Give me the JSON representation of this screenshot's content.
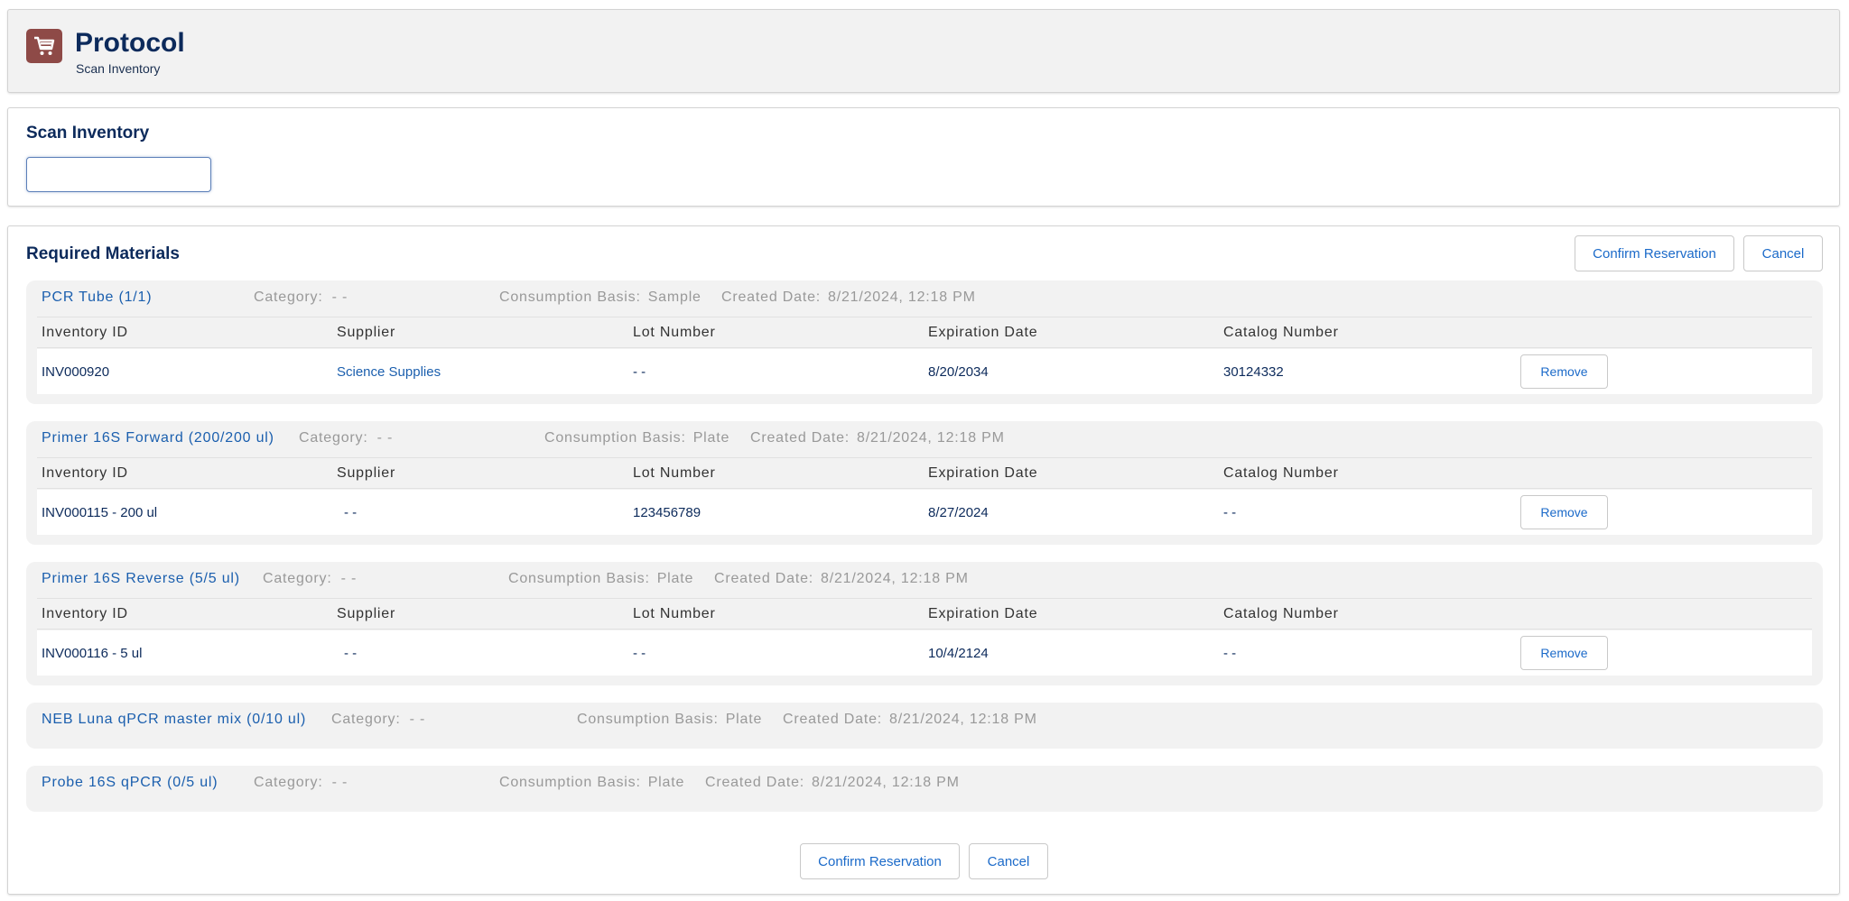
{
  "header": {
    "icon": "shopping-cart-icon",
    "icon_color": "#8e4a47",
    "title": "Protocol",
    "subtitle": "Scan Inventory"
  },
  "scan": {
    "label": "Scan Inventory",
    "input_value": "",
    "input_placeholder": ""
  },
  "materials": {
    "title": "Required Materials",
    "confirm_label": "Confirm Reservation",
    "cancel_label": "Cancel",
    "category_label": "Category:",
    "consumption_label": "Consumption Basis:",
    "created_label": "Created Date:",
    "columns": [
      "Inventory ID",
      "Supplier",
      "Lot Number",
      "Expiration Date",
      "Catalog Number"
    ],
    "remove_label": "Remove",
    "groups": [
      {
        "name": "PCR Tube (1/1)",
        "category": "- -",
        "consumption_basis": "Sample",
        "created_date": "8/21/2024, 12:18 PM",
        "rows": [
          {
            "inventory_id": "INV000920",
            "supplier": "Science Supplies",
            "lot_number": "- -",
            "expiration_date": "8/20/2034",
            "catalog_number": "30124332"
          }
        ]
      },
      {
        "name": "Primer 16S Forward (200/200 ul)",
        "category": "- -",
        "consumption_basis": "Plate",
        "created_date": "8/21/2024, 12:18 PM",
        "rows": [
          {
            "inventory_id": "INV000115 - 200 ul",
            "supplier": "- -",
            "lot_number": "123456789",
            "expiration_date": "8/27/2024",
            "catalog_number": "- -"
          }
        ]
      },
      {
        "name": "Primer 16S Reverse (5/5 ul)",
        "category": "- -",
        "consumption_basis": "Plate",
        "created_date": "8/21/2024, 12:18 PM",
        "rows": [
          {
            "inventory_id": "INV000116 - 5 ul",
            "supplier": "- -",
            "lot_number": "- -",
            "expiration_date": "10/4/2124",
            "catalog_number": "- -"
          }
        ]
      },
      {
        "name": "NEB Luna qPCR master mix (0/10 ul)",
        "category": "- -",
        "consumption_basis": "Plate",
        "created_date": "8/21/2024, 12:18 PM",
        "rows": []
      },
      {
        "name": "Probe 16S qPCR (0/5 ul)",
        "category": "- -",
        "consumption_basis": "Plate",
        "created_date": "8/21/2024, 12:18 PM",
        "rows": []
      }
    ]
  }
}
